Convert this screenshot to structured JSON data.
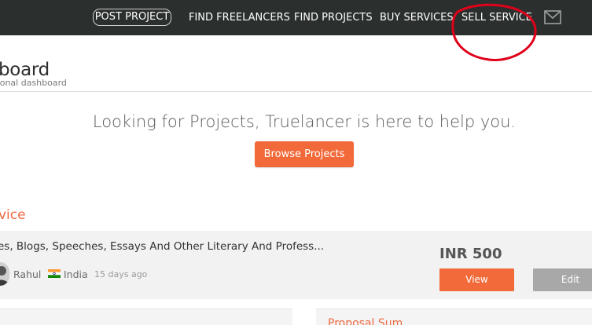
{
  "nav": {
    "post_project": "POST PROJECT",
    "find_freelancers": "FIND FREELANCERS",
    "find_projects": "FIND PROJECTS",
    "buy_services": "BUY SERVICES",
    "sell_service": "SELL SERVICE",
    "mail_icon": "envelope-icon",
    "background_color": "#2b302f"
  },
  "annotation": {
    "shape": "red-ellipse",
    "color": "#e0001a"
  },
  "header": {
    "title": "board",
    "subtitle": "sonal dashboard"
  },
  "promo": {
    "heading": "Looking for Projects, Truelancer is here to help you.",
    "button_label": "Browse Projects",
    "accent_color": "#f26a3a"
  },
  "section": {
    "title": "vice"
  },
  "service": {
    "title": "es, Blogs, Speeches, Essays And Other Literary And Profess...",
    "seller_name": "Rahul",
    "country_flag": "india-flag-icon",
    "country": "India",
    "posted": "15 days ago",
    "price": "INR 500",
    "view_label": "View",
    "edit_label": "Edit"
  },
  "bottom": {
    "right_title": "Proposal Sum"
  }
}
